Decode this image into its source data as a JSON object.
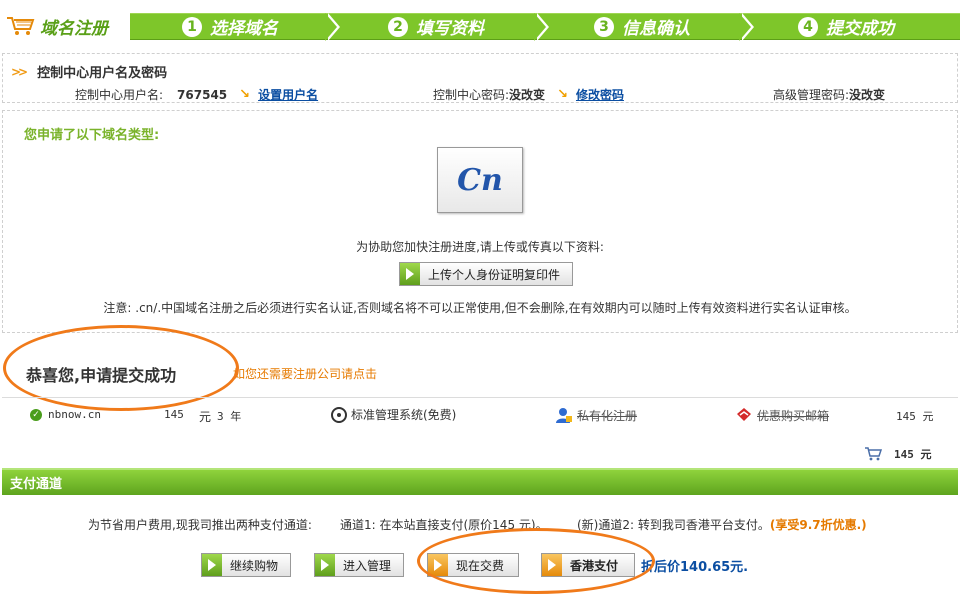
{
  "brand": {
    "label": "域名注册"
  },
  "steps": [
    {
      "num": "1",
      "label": "选择域名"
    },
    {
      "num": "2",
      "label": "填写资料"
    },
    {
      "num": "3",
      "label": "信息确认"
    },
    {
      "num": "4",
      "label": "提交成功"
    }
  ],
  "account": {
    "title": "控制中心用户名及密码",
    "username_label": "控制中心用户名:",
    "username_value": "767545",
    "set_username_link": "设置用户名",
    "password_label": "控制中心密码:",
    "password_value": "没改变",
    "change_password_link": "修改密码",
    "admin_password_label": "高级管理密码:",
    "admin_password_value": "没改变"
  },
  "domain_type": {
    "title": "您申请了以下域名类型:",
    "logo_text": "Cn",
    "help_text": "为协助您加快注册进度,请上传或传真以下资料:",
    "upload_button": "上传个人身份证明复印件",
    "note": "注意: .cn/.中国域名注册之后必须进行实名认证,否则域名将不可以正常使用,但不会删除,在有效期内可以随时上传有效资料进行实名认证审核。"
  },
  "result": {
    "congrats": "恭喜您,申请提交成功",
    "company_link": "如您还需要注册公司请点击"
  },
  "order": {
    "domain": "nbnow.cn",
    "price": "145",
    "unit": "元",
    "term": "3 年",
    "system": "标准管理系统(免费)",
    "privacy": "私有化注册",
    "mailbox": "优惠购买邮箱",
    "row_total": "145 元",
    "total": "145 元"
  },
  "payment": {
    "bar_title": "支付通道",
    "intro": "为节省用户费用,现我司推出两种支付通道:",
    "channel1": "通道1: 在本站直接支付(原价145 元)。",
    "channel2": "(新)通道2: 转到我司香港平台支付。",
    "channel2_discount": "(享受9.7折优惠.)",
    "buttons": {
      "continue": "继续购物",
      "manage": "进入管理",
      "pay_now": "现在交费",
      "hk_pay": "香港支付"
    },
    "final_price": "折后价140.65元."
  },
  "colors": {
    "accent_green": "#7ec62a",
    "highlight_orange": "#f07a1a",
    "link_blue": "#0b4ea2"
  }
}
